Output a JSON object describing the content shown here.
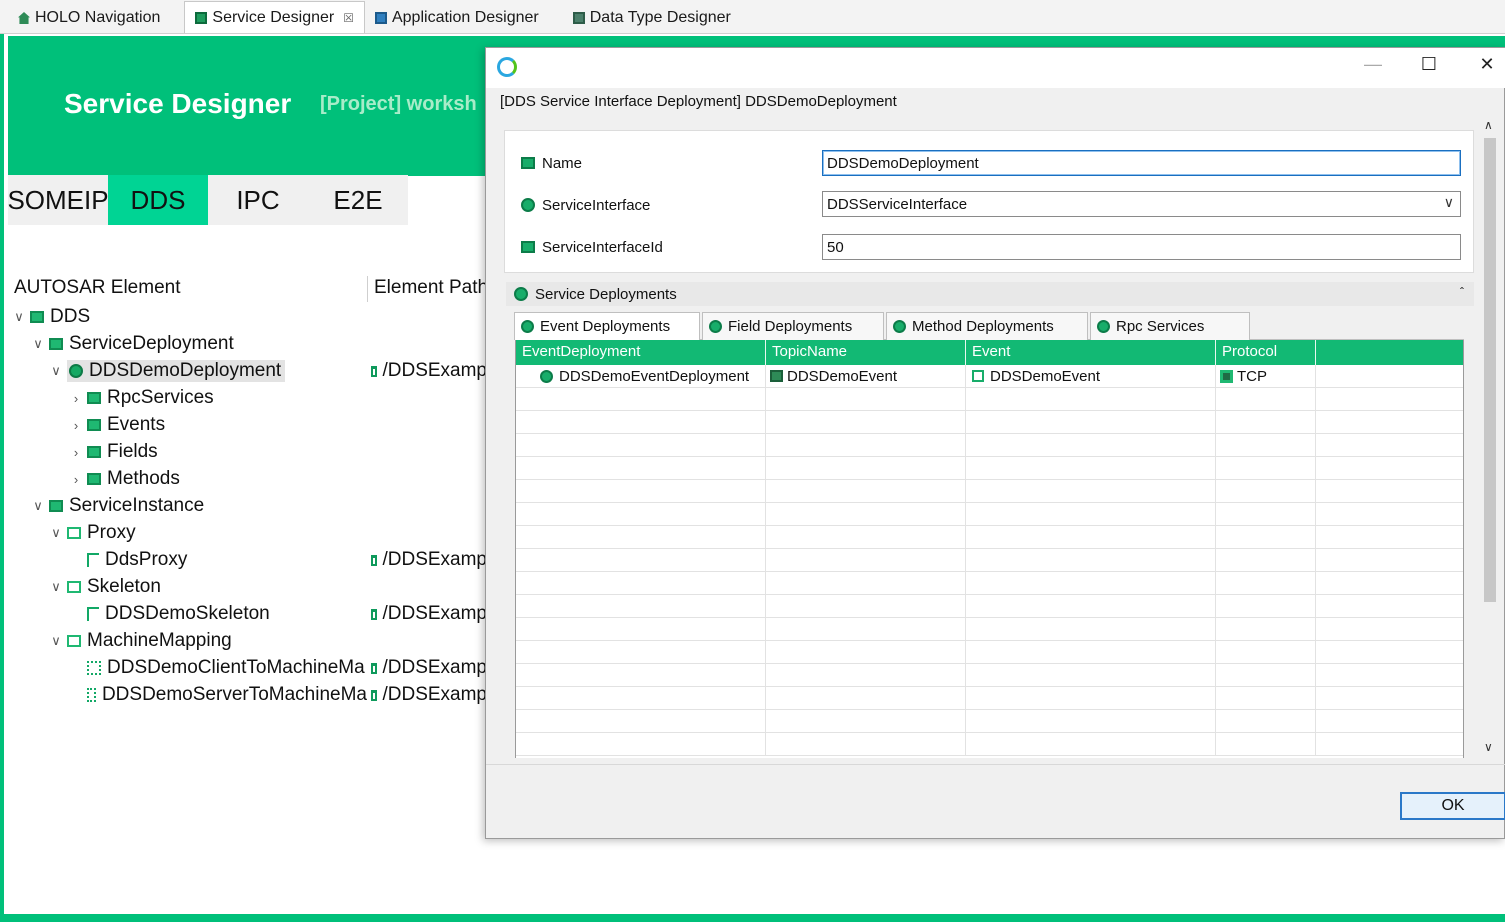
{
  "editor_tabs": [
    {
      "label": "HOLO Navigation",
      "icon": "house-icon"
    },
    {
      "label": "Service Designer",
      "icon": "service-designer-icon",
      "close": "☒"
    },
    {
      "label": "Application Designer",
      "icon": "application-designer-icon"
    },
    {
      "label": "Data Type Designer",
      "icon": "data-type-designer-icon"
    }
  ],
  "banner": {
    "title": "Service Designer",
    "project": "[Project] worksh"
  },
  "protocol_tabs": [
    "SOMEIP",
    "DDS",
    "IPC",
    "E2E"
  ],
  "tree": {
    "headers": {
      "element": "AUTOSAR Element",
      "path": "Element Path"
    },
    "rows": [
      {
        "label": "DDS",
        "chev": "∨",
        "icon": "folder-icon"
      },
      {
        "label": "ServiceDeployment",
        "chev": "∨",
        "icon": "folder-icon"
      },
      {
        "label": "DDSDemoDeployment",
        "chev": "∨",
        "icon": "deployment-icon",
        "path": "/DDSExamp"
      },
      {
        "label": "RpcServices",
        "chev": "›",
        "icon": "folder-icon"
      },
      {
        "label": "Events",
        "chev": "›",
        "icon": "folder-icon"
      },
      {
        "label": "Fields",
        "chev": "›",
        "icon": "folder-icon"
      },
      {
        "label": "Methods",
        "chev": "›",
        "icon": "folder-icon"
      },
      {
        "label": "ServiceInstance",
        "chev": "∨",
        "icon": "folder-icon"
      },
      {
        "label": "Proxy",
        "chev": "∨",
        "icon": "open-folder-icon"
      },
      {
        "label": "DdsProxy",
        "chev": "",
        "icon": "proxy-icon",
        "path": "/DDSExamp"
      },
      {
        "label": "Skeleton",
        "chev": "∨",
        "icon": "open-folder-icon"
      },
      {
        "label": "DDSDemoSkeleton",
        "chev": "",
        "icon": "skeleton-icon",
        "path": "/DDSExamp"
      },
      {
        "label": "MachineMapping",
        "chev": "∨",
        "icon": "open-folder-icon"
      },
      {
        "label": "DDSDemoClientToMachineMa",
        "chev": "",
        "icon": "mapping-icon",
        "path": "/DDSExamp"
      },
      {
        "label": "DDSDemoServerToMachineMa",
        "chev": "",
        "icon": "mapping-icon",
        "path": "/DDSExamp"
      }
    ]
  },
  "dialog": {
    "buttons": {
      "minimize": "—",
      "maximize": "☐",
      "close": "✕"
    },
    "caption": "[DDS Service Interface Deployment] DDSDemoDeployment",
    "fields": {
      "name": {
        "label": "Name",
        "value": "DDSDemoDeployment"
      },
      "service_interface": {
        "label": "ServiceInterface",
        "value": "DDSServiceInterface",
        "dropdown": "∨"
      },
      "service_interface_id": {
        "label": "ServiceInterfaceId",
        "value": "50"
      }
    },
    "section": {
      "label": "Service Deployments",
      "collapse": "ˆ"
    },
    "sub_tabs": [
      "Event Deployments",
      "Field Deployments",
      "Method Deployments",
      "Rpc Services"
    ],
    "grid": {
      "columns": [
        "EventDeployment",
        "TopicName",
        "Event",
        "Protocol",
        ""
      ],
      "rows": [
        {
          "event_deployment": "DDSDemoEventDeployment",
          "topic_name": "DDSDemoEvent",
          "event": "DDSDemoEvent",
          "protocol": "TCP"
        }
      ]
    },
    "scroll": {
      "up": "∧",
      "down": "∨"
    },
    "ok_label": "OK"
  },
  "colors": {
    "accent": "#00c07a",
    "active_tab": "#00d494",
    "grid_header": "#12b974",
    "ok_border": "#2a78c8"
  }
}
